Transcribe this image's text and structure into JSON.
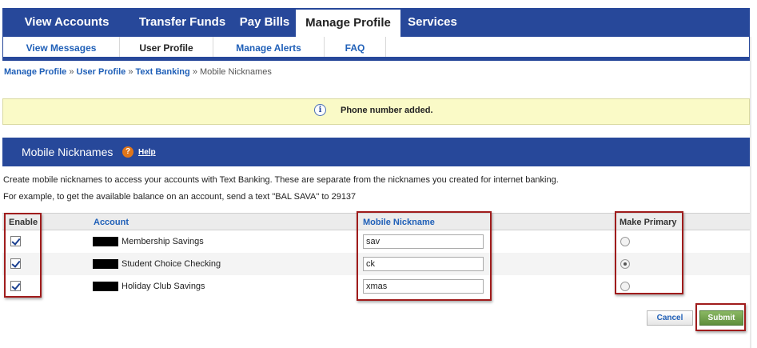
{
  "top_nav": {
    "tabs": [
      {
        "label": "View Accounts"
      },
      {
        "label": "Transfer Funds"
      },
      {
        "label": "Pay Bills"
      },
      {
        "label": "Manage Profile",
        "active": true
      },
      {
        "label": "Services"
      }
    ]
  },
  "sub_nav": {
    "tabs": [
      {
        "label": "View Messages"
      },
      {
        "label": "User Profile",
        "active": true
      },
      {
        "label": "Manage Alerts"
      },
      {
        "label": "FAQ"
      }
    ]
  },
  "breadcrumb": {
    "items": [
      "Manage Profile",
      "User Profile",
      "Text Banking"
    ],
    "separator": "»",
    "current": "Mobile Nicknames"
  },
  "alert": {
    "icon": "info-icon",
    "message": "Phone number added."
  },
  "section": {
    "title": "Mobile Nicknames",
    "help_icon": "question-icon",
    "help_label": "Help"
  },
  "description": {
    "line1": "Create mobile nicknames to access your accounts with Text Banking. These are separate from the nicknames you created for internet banking.",
    "line2": "For example, to get the available balance on an account, send a text \"BAL SAVA\" to 29137"
  },
  "table": {
    "columns": {
      "enable": "Enable",
      "account": "Account",
      "nickname": "Mobile Nickname",
      "primary": "Make Primary"
    },
    "rows": [
      {
        "enabled": true,
        "account": "Membership Savings",
        "nickname": "sav",
        "primary": false
      },
      {
        "enabled": true,
        "account": "Student Choice Checking",
        "nickname": "ck",
        "primary": true
      },
      {
        "enabled": true,
        "account": "Holiday Club Savings",
        "nickname": "xmas",
        "primary": false
      }
    ]
  },
  "actions": {
    "cancel_label": "Cancel",
    "submit_label": "Submit"
  },
  "colors": {
    "nav_blue": "#27489a",
    "link_blue": "#2060b8",
    "alert_bg": "#fafac7",
    "submit_green": "#6e9e48",
    "highlight_red": "#a01c1c"
  }
}
